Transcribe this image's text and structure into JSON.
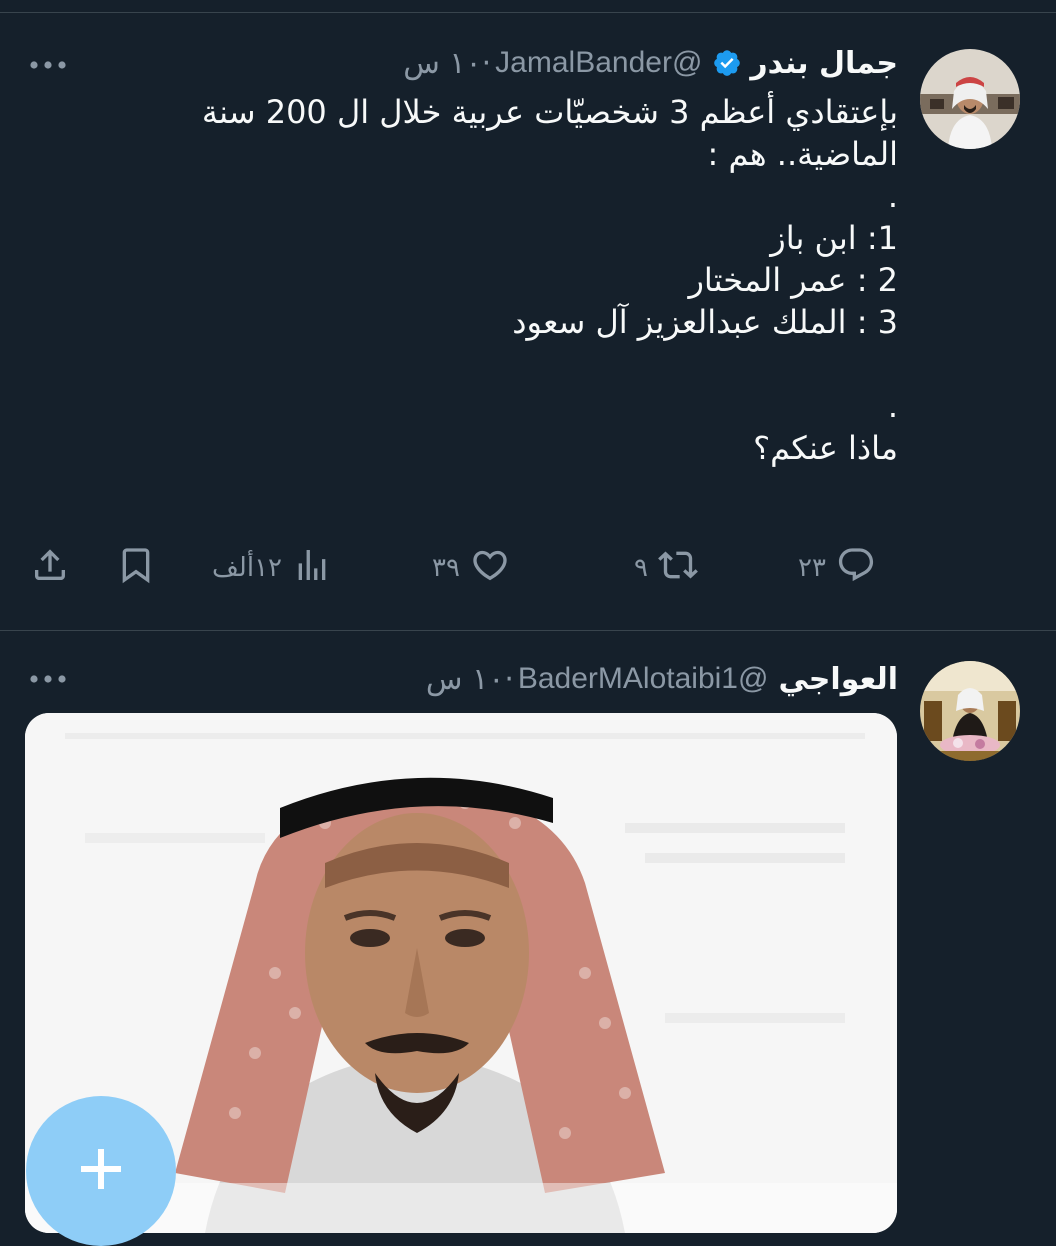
{
  "tweets": [
    {
      "display_name": "جمال بندر",
      "handle": "@JamalBander",
      "separator": "·",
      "time": "١٠ س",
      "body_lines": [
        "بإعتقادي أعظم 3 شخصيّات عربية خلال ال 200 سنة",
        "الماضية.. هم :",
        ".",
        "1: ابن باز",
        "2 : عمر المختار",
        "3 : الملك عبدالعزيز آل سعود",
        "",
        ".",
        "ماذا عنكم؟"
      ],
      "actions": {
        "reply_count": "٢٣",
        "retweet_count": "٩",
        "like_count": "٣٩",
        "views_count": "١٢ألف"
      }
    },
    {
      "display_name": "العواجي",
      "handle": "@BaderMAlotaibi1",
      "separator": "·",
      "time": "١٠ س"
    }
  ],
  "icons": {
    "verified": "verified-badge-icon",
    "more": "more-dots-icon",
    "reply": "reply-icon",
    "retweet": "retweet-icon",
    "like": "heart-icon",
    "views": "views-icon",
    "bookmark": "bookmark-icon",
    "share": "share-icon",
    "compose": "plus-icon"
  },
  "colors": {
    "background": "#15202b",
    "text_primary": "#f7f9f9",
    "text_secondary": "#8b98a5",
    "divider": "#38444d",
    "verified_blue": "#1d9bf0",
    "fab": "#8ecdf7"
  }
}
